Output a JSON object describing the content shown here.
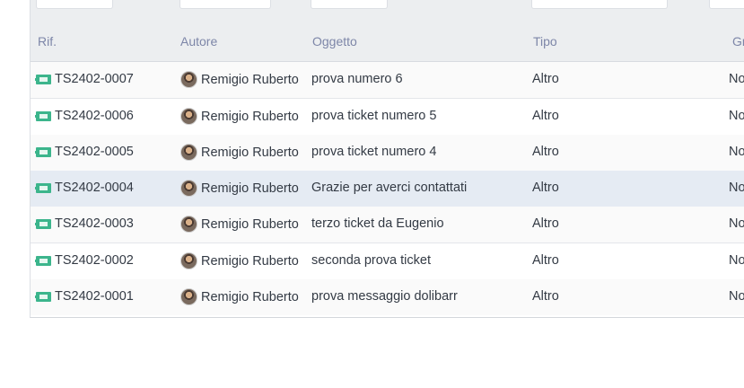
{
  "table": {
    "headers": {
      "ref": "Rif.",
      "author": "Autore",
      "subject": "Oggetto",
      "type": "Tipo",
      "group": "Gr"
    },
    "rows": [
      {
        "ref": "TS2402-0007",
        "author": "Remigio Ruberto",
        "subject": "prova numero 6",
        "type": "Altro",
        "group": "No"
      },
      {
        "ref": "TS2402-0006",
        "author": "Remigio Ruberto",
        "subject": "prova ticket numero 5",
        "type": "Altro",
        "group": "No"
      },
      {
        "ref": "TS2402-0005",
        "author": "Remigio Ruberto",
        "subject": "prova ticket numero 4",
        "type": "Altro",
        "group": "No"
      },
      {
        "ref": "TS2402-0004",
        "author": "Remigio Ruberto",
        "subject": "Grazie per averci contattati",
        "type": "Altro",
        "group": "No"
      },
      {
        "ref": "TS2402-0003",
        "author": "Remigio Ruberto",
        "subject": "terzo ticket da Eugenio",
        "type": "Altro",
        "group": "No"
      },
      {
        "ref": "TS2402-0002",
        "author": "Remigio Ruberto",
        "subject": "seconda prova ticket",
        "type": "Altro",
        "group": "No"
      },
      {
        "ref": "TS2402-0001",
        "author": "Remigio Ruberto",
        "subject": "prova messaggio dolibarr",
        "type": "Altro",
        "group": "No"
      }
    ],
    "row_icon": "ticket-icon",
    "avatar_icon": "user-avatar",
    "colors": {
      "header_bg": "#eceef0",
      "header_text": "#7d86a8",
      "ticket_icon": "#3cb58c",
      "highlight_row": "#e5ebf3"
    }
  }
}
